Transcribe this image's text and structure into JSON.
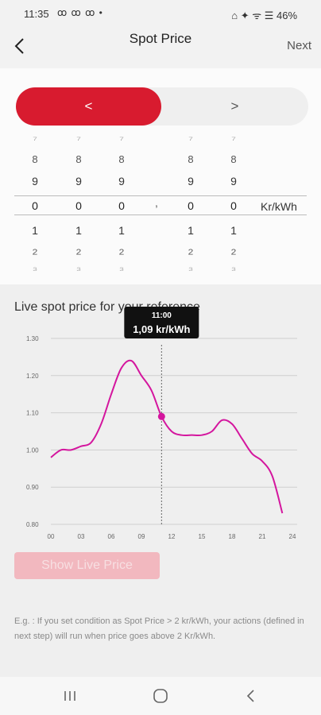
{
  "status_bar": {
    "time": "11:35",
    "notif_icons": "ꝏ ꝏ ꝏ •",
    "right": "⌂ ✦ ᯤ ☰ 46%"
  },
  "header": {
    "title": "Spot Price",
    "next_label": "Next"
  },
  "segmented": {
    "left_label": "<",
    "right_label": ">"
  },
  "picker": {
    "columns": [
      {
        "above": [
          "7",
          "8",
          "9"
        ],
        "selected": "0",
        "below": [
          "1",
          "2",
          "3"
        ]
      },
      {
        "above": [
          "7",
          "8",
          "9"
        ],
        "selected": "0",
        "below": [
          "1",
          "2",
          "3"
        ]
      },
      {
        "above": [
          "7",
          "8",
          "9"
        ],
        "selected": "0",
        "below": [
          "1",
          "2",
          "3"
        ]
      },
      {
        "above": [
          "7",
          "8",
          "9"
        ],
        "selected": "0",
        "below": [
          "1",
          "2",
          "3"
        ]
      },
      {
        "above": [
          "7",
          "8",
          "9"
        ],
        "selected": "0",
        "below": [
          "1",
          "2",
          "3"
        ]
      }
    ],
    "decimal_separator": ",",
    "unit": "Kr/kWh"
  },
  "live": {
    "title": "Live spot price for your reference",
    "show_button_label": "Show Live Price",
    "note": "E.g. : If you set condition as Spot Price > 2 kr/kWh, your actions (defined in next step) will run when price goes above 2 Kr/kWh."
  },
  "chart_data": {
    "type": "line",
    "x_ticks": [
      "00",
      "03",
      "06",
      "09",
      "12",
      "15",
      "18",
      "21",
      "24"
    ],
    "y_ticks": [
      "0.80",
      "0.90",
      "1.00",
      "1.10",
      "1.20",
      "1.30"
    ],
    "xlim": [
      0,
      24
    ],
    "ylim": [
      0.8,
      1.3
    ],
    "series": [
      {
        "color": "#d4169e",
        "x": [
          0,
          1,
          2,
          3,
          4,
          5,
          6,
          7,
          8,
          9,
          10,
          11,
          12,
          13,
          14,
          15,
          16,
          17,
          18,
          19,
          20,
          21,
          22,
          23
        ],
        "y": [
          0.98,
          1.0,
          1.0,
          1.01,
          1.02,
          1.07,
          1.15,
          1.22,
          1.24,
          1.2,
          1.16,
          1.09,
          1.05,
          1.04,
          1.04,
          1.04,
          1.05,
          1.08,
          1.07,
          1.03,
          0.99,
          0.97,
          0.93,
          0.83
        ]
      }
    ],
    "tooltip": {
      "x": 11,
      "y": 1.09,
      "time": "11:00",
      "value": "1,09 kr/kWh"
    },
    "grid": true
  },
  "colors": {
    "accent": "#d81b2f",
    "line": "#d4169e"
  }
}
